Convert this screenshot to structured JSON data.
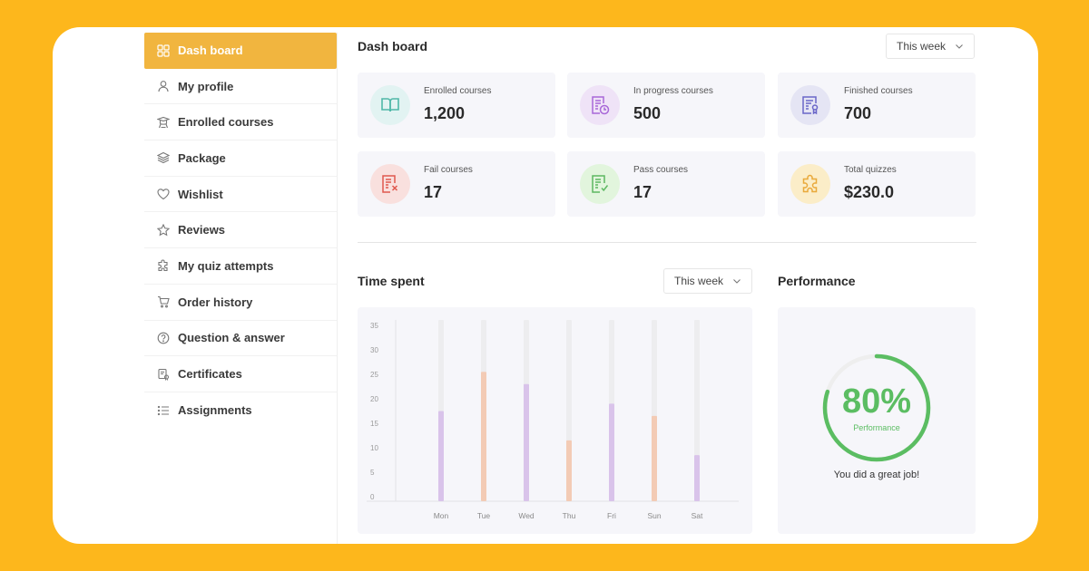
{
  "sidebar": {
    "items": [
      {
        "label": "Dash board",
        "icon": "grid-icon",
        "active": true
      },
      {
        "label": "My profile",
        "icon": "user-icon"
      },
      {
        "label": "Enrolled courses",
        "icon": "graduation-icon"
      },
      {
        "label": "Package",
        "icon": "layers-icon"
      },
      {
        "label": "Wishlist",
        "icon": "heart-icon"
      },
      {
        "label": "Reviews",
        "icon": "star-icon"
      },
      {
        "label": "My quiz attempts",
        "icon": "puzzle-icon"
      },
      {
        "label": "Order history",
        "icon": "cart-icon"
      },
      {
        "label": "Question & answer",
        "icon": "question-circle-icon"
      },
      {
        "label": "Certificates",
        "icon": "certificate-icon"
      },
      {
        "label": "Assignments",
        "icon": "list-icon"
      }
    ]
  },
  "header": {
    "title": "Dash board",
    "period_select": "This week"
  },
  "stats": [
    {
      "label": "Enrolled courses",
      "value": "1,200",
      "icon": "book-icon",
      "color": "#4FB8A8",
      "bg": "#E2F3F2"
    },
    {
      "label": "In progress courses",
      "value": "500",
      "icon": "document-clock-icon",
      "color": "#A968D8",
      "bg": "#EFE3F7"
    },
    {
      "label": "Finished courses",
      "value": "700",
      "icon": "document-badge-icon",
      "color": "#6A66C8",
      "bg": "#E5E5F4"
    },
    {
      "label": "Fail courses",
      "value": "17",
      "icon": "document-x-icon",
      "color": "#E0584E",
      "bg": "#F9E0DE"
    },
    {
      "label": "Pass courses",
      "value": "17",
      "icon": "document-check-icon",
      "color": "#5DB862",
      "bg": "#E2F5DD"
    },
    {
      "label": "Total quizzes",
      "value": "$230.0",
      "icon": "puzzle-icon",
      "color": "#E9A93A",
      "bg": "#FBEDC8"
    }
  ],
  "time_spent": {
    "title": "Time spent",
    "period_select": "This week"
  },
  "chart_data": {
    "type": "bar",
    "title": "Time spent",
    "xlabel": "",
    "ylabel": "",
    "categories": [
      "Mon",
      "Tue",
      "Wed",
      "Thu",
      "Fri",
      "Sun",
      "Sat"
    ],
    "values": [
      17.5,
      25.5,
      23,
      11.5,
      19,
      16.5,
      8.5
    ],
    "bar_colors": [
      "#D9C3EA",
      "#F3CBB5",
      "#D9C3EA",
      "#F3CBB5",
      "#D9C3EA",
      "#F3CBB5",
      "#D9C3EA"
    ],
    "track_color": "#EDEDEF",
    "yticks": [
      0,
      5,
      10,
      15,
      20,
      25,
      30,
      35
    ],
    "ylim": [
      0,
      35
    ],
    "grid": false,
    "legend": "none"
  },
  "performance": {
    "title": "Performance",
    "percent_label": "80%",
    "value": 0.8,
    "sub_label": "Performance",
    "message": "You did a great job!",
    "color": "#5BBD62",
    "track_color": "#EEEEEE"
  }
}
